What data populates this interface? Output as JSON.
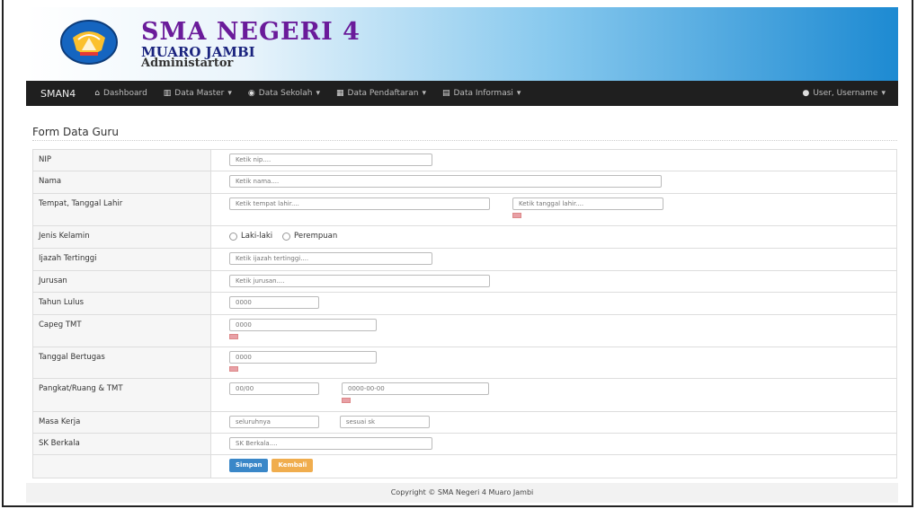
{
  "header": {
    "school_name": "SMA NEGERI 4",
    "city": "MUARO JAMBI",
    "role": "Administartor"
  },
  "navbar": {
    "brand": "SMAN4",
    "items": [
      {
        "label": "Dashboard",
        "icon": "home-icon"
      },
      {
        "label": "Data Master",
        "icon": "book-icon"
      },
      {
        "label": "Data Sekolah",
        "icon": "map-marker-icon"
      },
      {
        "label": "Data Pendaftaran",
        "icon": "grid-icon"
      },
      {
        "label": "Data Informasi",
        "icon": "bookmark-icon"
      }
    ],
    "user": "User, Username"
  },
  "form": {
    "title": "Form Data Guru",
    "rows": {
      "nip": {
        "label": "NIP",
        "placeholder": "Ketik nip...."
      },
      "nama": {
        "label": "Nama",
        "placeholder": "Ketik nama...."
      },
      "ttl": {
        "label": "Tempat, Tanggal Lahir",
        "place_placeholder": "Ketik tempat lahir....",
        "date_placeholder": "Ketik tanggal lahir...."
      },
      "jk": {
        "label": "Jenis Kelamin",
        "option1": "Laki-laki",
        "option2": "Perempuan"
      },
      "ijazah": {
        "label": "Ijazah Tertinggi",
        "placeholder": "Ketik ijazah tertinggi...."
      },
      "jurusan": {
        "label": "Jurusan",
        "placeholder": "Ketik jurusan...."
      },
      "tahun_lulus": {
        "label": "Tahun Lulus",
        "placeholder": "0000"
      },
      "capeg": {
        "label": "Capeg TMT",
        "placeholder": "0000"
      },
      "tgl_bertugas": {
        "label": "Tanggal Bertugas",
        "placeholder": "0000"
      },
      "pangkat": {
        "label": "Pangkat/Ruang & TMT",
        "pangkat_placeholder": "00/00",
        "tmt_placeholder": "0000-00-00"
      },
      "masa_kerja": {
        "label": "Masa Kerja",
        "a_placeholder": "seluruhnya",
        "b_placeholder": "sesuai sk"
      },
      "sk": {
        "label": "SK Berkala",
        "placeholder": "SK Berkala...."
      }
    },
    "save_label": "Simpan",
    "back_label": "Kembali"
  },
  "footer": "Copyright © SMA Negeri 4 Muaro Jambi",
  "colors": {
    "navbar": "#1f1f1f",
    "save": "#3a87c8",
    "back": "#f0ad4e",
    "title": "#6a1b9a"
  }
}
